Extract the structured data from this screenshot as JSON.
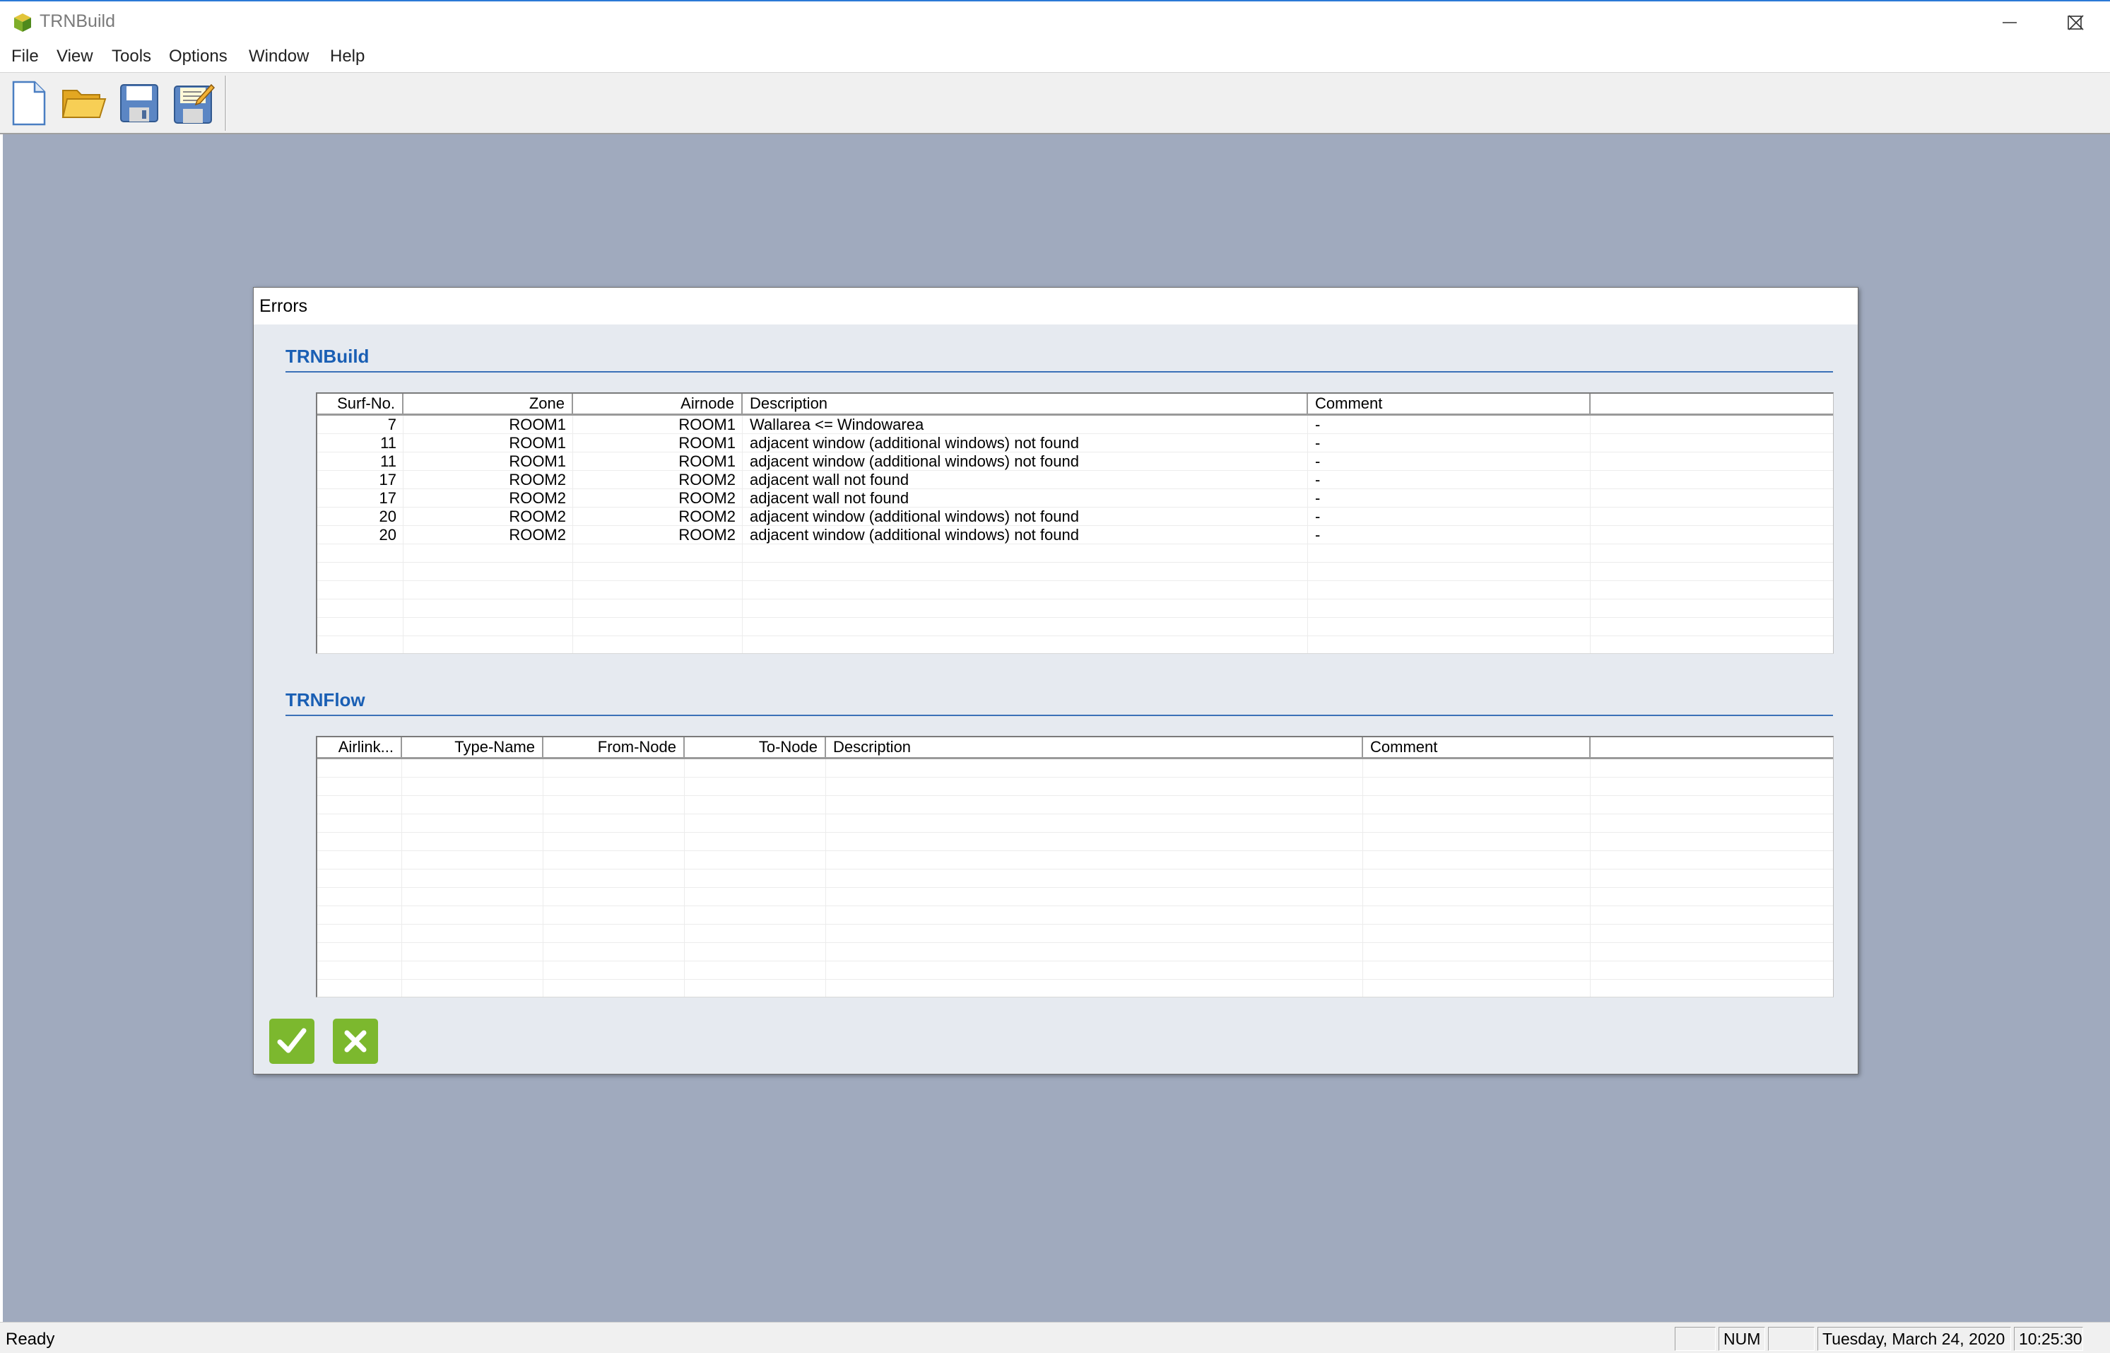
{
  "window": {
    "title": "TRNBuild",
    "app_icon": "trnbuild-cube-icon",
    "controls": [
      "minimize-icon",
      "maximize-icon",
      "close-icon"
    ]
  },
  "menu": [
    "File",
    "View",
    "Tools",
    "Options",
    "Window",
    "Help"
  ],
  "toolbar": [
    "new-file-icon",
    "open-folder-icon",
    "save-icon",
    "save-as-icon"
  ],
  "dialog": {
    "title": "Errors",
    "trnbuild": {
      "heading": "TRNBuild",
      "columns": [
        "Surf-No.",
        "Zone",
        "Airnode",
        "Description",
        "Comment",
        ""
      ],
      "rows": [
        [
          "7",
          "ROOM1",
          "ROOM1",
          "Wallarea <= Windowarea",
          "-"
        ],
        [
          "11",
          "ROOM1",
          "ROOM1",
          "adjacent window (additional windows) not found",
          "-"
        ],
        [
          "11",
          "ROOM1",
          "ROOM1",
          "adjacent window (additional windows) not found",
          "-"
        ],
        [
          "17",
          "ROOM2",
          "ROOM2",
          "adjacent wall not found",
          "-"
        ],
        [
          "17",
          "ROOM2",
          "ROOM2",
          "adjacent wall not found",
          "-"
        ],
        [
          "20",
          "ROOM2",
          "ROOM2",
          "adjacent window (additional windows) not found",
          "-"
        ],
        [
          "20",
          "ROOM2",
          "ROOM2",
          "adjacent window (additional windows) not found",
          "-"
        ]
      ]
    },
    "trnflow": {
      "heading": "TRNFlow",
      "columns": [
        "Airlink...",
        "Type-Name",
        "From-Node",
        "To-Node",
        "Description",
        "Comment",
        ""
      ],
      "rows": []
    },
    "buttons": [
      "ok-check-icon",
      "cancel-x-icon"
    ]
  },
  "status": {
    "text": "Ready",
    "panes": [
      "",
      "NUM",
      "",
      "Tuesday, March 24, 2020",
      "10:25:30"
    ]
  },
  "colors": {
    "mdi_background": "#a0aabe",
    "dialog_background": "#e6eaf0",
    "section_heading": "#1a5fb4",
    "dialog_button_green": "#7cb82e"
  }
}
